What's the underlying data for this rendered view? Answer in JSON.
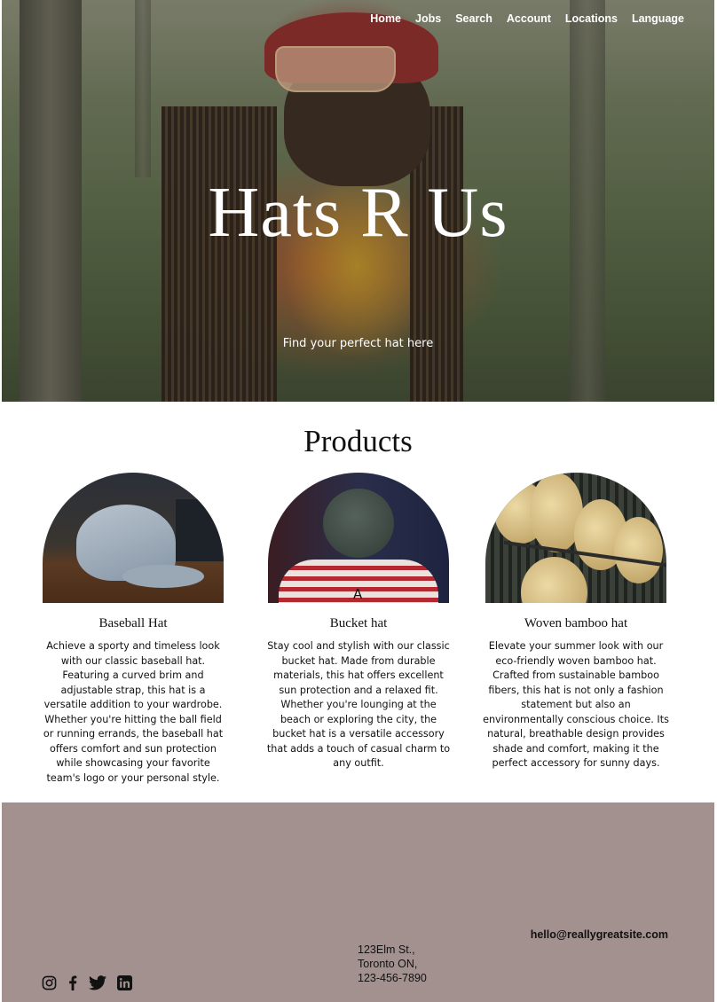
{
  "nav": {
    "items": [
      "Home",
      "Jobs",
      "Search",
      "Account",
      "Locations",
      "Language"
    ]
  },
  "hero": {
    "title": "Hats R Us",
    "subtitle": "Find your perfect hat here"
  },
  "products": {
    "heading": "Products",
    "items": [
      {
        "name": "Baseball Hat",
        "image_icon": "baseball-cap-photo",
        "description": "Achieve a sporty and timeless look with our classic baseball hat. Featuring a curved brim and adjustable strap, this hat is a versatile addition to your wardrobe. Whether you're hitting the ball field or running errands, the baseball hat offers comfort and sun protection while showcasing your favorite team's logo or your personal style."
      },
      {
        "name": "Bucket hat",
        "image_icon": "bucket-hat-photo",
        "image_overlay_text": "A",
        "description": "Stay cool and stylish with our classic bucket hat. Made from durable materials, this hat offers excellent sun protection and a relaxed fit. Whether you're lounging at the beach or exploring the city, the bucket hat is a versatile accessory that adds a touch of casual charm to any outfit."
      },
      {
        "name": "Woven bamboo hat",
        "image_icon": "bamboo-hat-photo",
        "description": "Elevate your summer look with our eco-friendly woven bamboo hat. Crafted from sustainable bamboo fibers, this hat is not only a fashion statement but also an environmentally conscious choice. Its natural, breathable design provides shade and comfort, making it the perfect accessory for sunny days."
      }
    ]
  },
  "footer": {
    "background": "#a39190",
    "email": "hello@reallygreatsite.com",
    "address_line1": "123Elm St.,",
    "address_line2": "Toronto ON,",
    "phone": "123-456-7890",
    "socials": [
      "instagram-icon",
      "facebook-icon",
      "twitter-icon",
      "linkedin-icon"
    ]
  }
}
